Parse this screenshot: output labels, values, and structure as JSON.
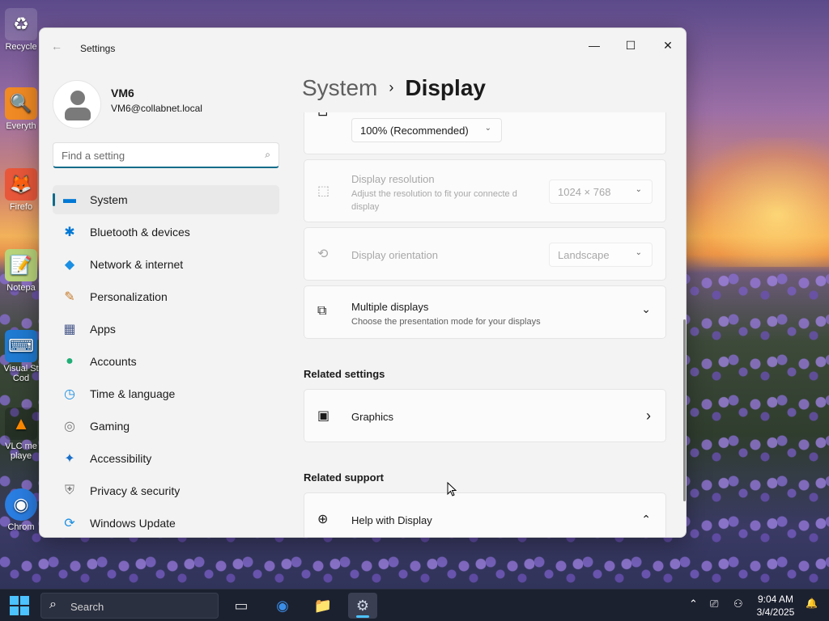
{
  "desktop": {
    "icons": [
      {
        "label": "Recycle",
        "glyph": "♻"
      },
      {
        "label": "Everyth",
        "glyph": "🔍"
      },
      {
        "label": "Firefo",
        "glyph": "🦊"
      },
      {
        "label": "Notepa",
        "glyph": "📝"
      },
      {
        "label": "Visual St",
        "label2": "Cod",
        "glyph": "⌨"
      },
      {
        "label": "VLC me",
        "label2": "playe",
        "glyph": "▲"
      },
      {
        "label": "Chrom",
        "glyph": "◉"
      }
    ]
  },
  "window": {
    "title": "Settings",
    "back_glyph": "←",
    "minimize_glyph": "—",
    "maximize_glyph": "☐",
    "close_glyph": "✕"
  },
  "profile": {
    "name": "VM6",
    "email": "VM6@collabnet.local"
  },
  "search": {
    "placeholder": "Find a setting",
    "icon_glyph": "⌕"
  },
  "nav": {
    "items": [
      {
        "label": "System",
        "glyph": "▬",
        "color": "#0078d4"
      },
      {
        "label": "Bluetooth & devices",
        "glyph": "✱",
        "color": "#0078d4"
      },
      {
        "label": "Network & internet",
        "glyph": "◆",
        "color": "#1a8fe3"
      },
      {
        "label": "Personalization",
        "glyph": "✎",
        "color": "#c77b2b"
      },
      {
        "label": "Apps",
        "glyph": "▦",
        "color": "#4a5b8c"
      },
      {
        "label": "Accounts",
        "glyph": "●",
        "color": "#1fae76"
      },
      {
        "label": "Time & language",
        "glyph": "◷",
        "color": "#1a8fe3"
      },
      {
        "label": "Gaming",
        "glyph": "◎",
        "color": "#7a7a7a"
      },
      {
        "label": "Accessibility",
        "glyph": "✦",
        "color": "#1a6fc9"
      },
      {
        "label": "Privacy & security",
        "glyph": "⛨",
        "color": "#7a7a7a"
      },
      {
        "label": "Windows Update",
        "glyph": "⟳",
        "color": "#1a8fe3"
      }
    ],
    "active_index": 0
  },
  "breadcrumb": {
    "parent": "System",
    "separator": "›",
    "current": "Display"
  },
  "content": {
    "scale": {
      "value": "100% (Recommended)",
      "chevron": "⌄"
    },
    "resolution": {
      "title": "Display resolution",
      "subtitle": "Adjust the resolution to fit your connecte d display",
      "value": "1024 × 768",
      "chevron": "⌄",
      "icon_glyph": "⬚"
    },
    "orientation": {
      "title": "Display orientation",
      "value": "Landscape",
      "chevron": "⌄",
      "icon_glyph": "⟲"
    },
    "multiple_displays": {
      "title": "Multiple displays",
      "subtitle": "Choose the presentation mode for your displays",
      "chevron": "⌄",
      "icon_glyph": "⧉"
    },
    "related_settings": {
      "heading": "Related settings",
      "graphics": {
        "title": "Graphics",
        "chevron": "›",
        "icon_glyph": "▣"
      }
    },
    "related_support": {
      "heading": "Related support",
      "help": {
        "title": "Help with Display",
        "chevron": "⌃",
        "icon_glyph": "⊕"
      }
    }
  },
  "taskbar": {
    "search_placeholder": "Search",
    "search_glyph": "⌕",
    "apps": [
      {
        "name": "task-view",
        "glyph": "▭"
      },
      {
        "name": "chrome",
        "glyph": "◉"
      },
      {
        "name": "file-explorer",
        "glyph": "📁"
      },
      {
        "name": "settings",
        "glyph": "⚙"
      }
    ],
    "tray": {
      "chevron": "⌃",
      "network_glyph": "⎚",
      "accessibility_glyph": "⚇",
      "notification_glyph": "🔔"
    },
    "time": "9:04 AM",
    "date": "3/4/2025"
  }
}
